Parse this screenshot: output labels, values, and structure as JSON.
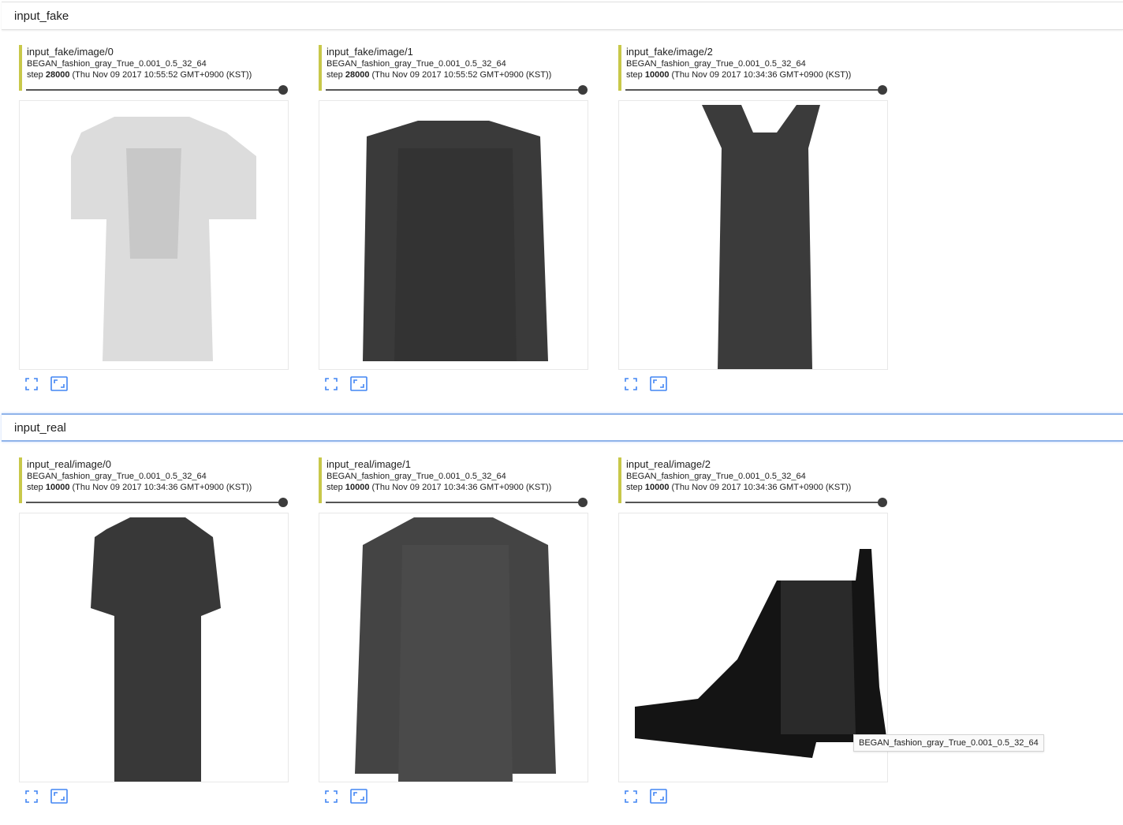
{
  "sections": [
    {
      "title": "input_fake",
      "cards": [
        {
          "tag": "input_fake/image/0",
          "run": "BEGAN_fashion_gray_True_0.001_0.5_32_64",
          "step_label": "step",
          "step": "28000",
          "timestamp": "(Thu Nov 09 2017 10:55:52 GMT+0900 (KST))",
          "image_content": "light gray t-shirt/dress"
        },
        {
          "tag": "input_fake/image/1",
          "run": "BEGAN_fashion_gray_True_0.001_0.5_32_64",
          "step_label": "step",
          "step": "28000",
          "timestamp": "(Thu Nov 09 2017 10:55:52 GMT+0900 (KST))",
          "image_content": "dark gray pullover"
        },
        {
          "tag": "input_fake/image/2",
          "run": "BEGAN_fashion_gray_True_0.001_0.5_32_64",
          "step_label": "step",
          "step": "10000",
          "timestamp": "(Thu Nov 09 2017 10:34:36 GMT+0900 (KST))",
          "image_content": "dark dress"
        }
      ]
    },
    {
      "title": "input_real",
      "cards": [
        {
          "tag": "input_real/image/0",
          "run": "BEGAN_fashion_gray_True_0.001_0.5_32_64",
          "step_label": "step",
          "step": "10000",
          "timestamp": "(Thu Nov 09 2017 10:34:36 GMT+0900 (KST))",
          "image_content": "dark dress"
        },
        {
          "tag": "input_real/image/1",
          "run": "BEGAN_fashion_gray_True_0.001_0.5_32_64",
          "step_label": "step",
          "step": "10000",
          "timestamp": "(Thu Nov 09 2017 10:34:36 GMT+0900 (KST))",
          "image_content": "dark pullover"
        },
        {
          "tag": "input_real/image/2",
          "run": "BEGAN_fashion_gray_True_0.001_0.5_32_64",
          "step_label": "step",
          "step": "10000",
          "timestamp": "(Thu Nov 09 2017 10:34:36 GMT+0900 (KST))",
          "image_content": "black ankle boot"
        }
      ]
    }
  ],
  "slider_value": 1.0,
  "tooltip": "BEGAN_fashion_gray_True_0.001_0.5_32_64",
  "icons": {
    "expand": "fullscreen-icon",
    "actual_size": "actual-size-icon"
  },
  "colors": {
    "run_indicator": "#c8c84a",
    "icon_blue": "#4285f4",
    "active_header_border": "#90b4ea"
  }
}
